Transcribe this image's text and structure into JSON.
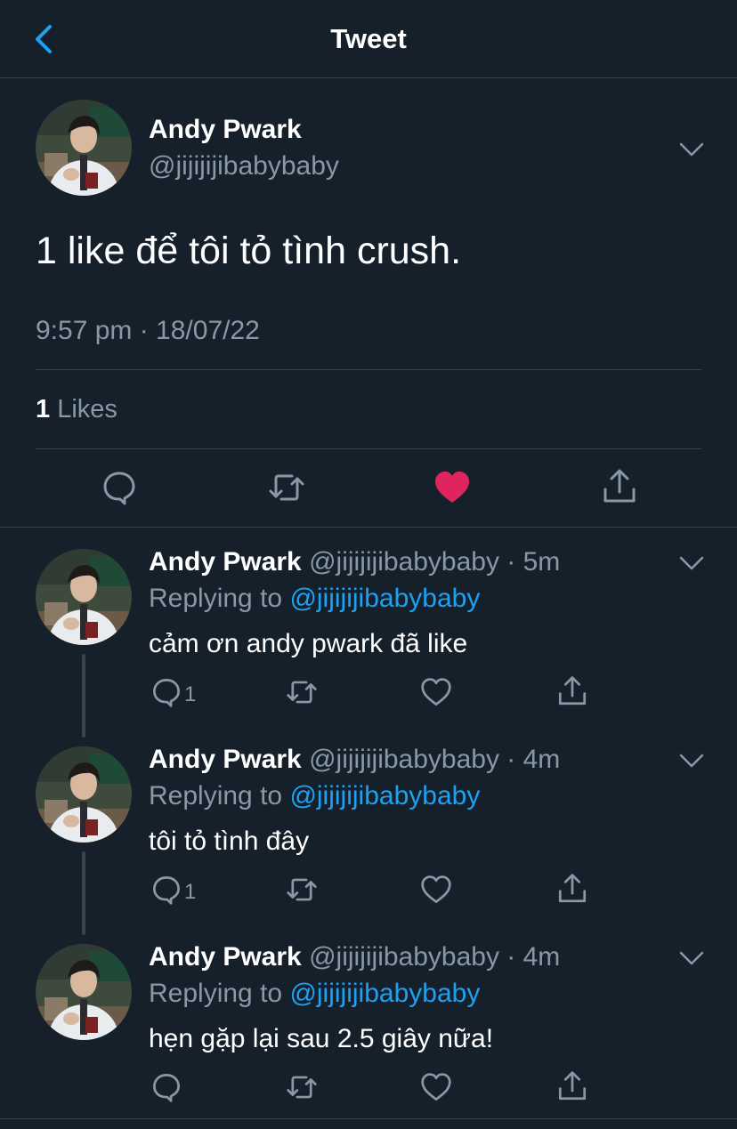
{
  "header": {
    "title": "Tweet"
  },
  "main_tweet": {
    "author_name": "Andy Pwark",
    "author_handle": "@jijijijibabybaby",
    "text": "1 like để tôi tỏ tình crush.",
    "timestamp": "9:57 pm · 18/07/22",
    "likes_count": "1",
    "likes_label": "Likes",
    "liked": true
  },
  "replies": [
    {
      "author_name": "Andy Pwark",
      "meta": "@jijijijibabybaby · 5m",
      "replying_prefix": "Replying to",
      "replying_to": "@jijijijibabybaby",
      "text": "cảm ơn andy pwark đã like",
      "reply_count": "1"
    },
    {
      "author_name": "Andy Pwark",
      "meta": "@jijijijibabybaby · 4m",
      "replying_prefix": "Replying to",
      "replying_to": "@jijijijibabybaby",
      "text": "tôi tỏ tình đây",
      "reply_count": "1"
    },
    {
      "author_name": "Andy Pwark",
      "meta": "@jijijijibabybaby · 4m",
      "replying_prefix": "Replying to",
      "replying_to": "@jijijijibabybaby",
      "text": "hẹn gặp lại sau 2.5 giây nữa!",
      "reply_count": ""
    }
  ],
  "colors": {
    "background": "#15202b",
    "accent": "#1da1f2",
    "like": "#e0245e",
    "secondary_text": "#8899a6",
    "divider": "#38444d"
  },
  "icons": {
    "back": "chevron-left-icon",
    "more": "chevron-down-icon",
    "reply": "comment-icon",
    "retweet": "retweet-icon",
    "like": "heart-icon",
    "share": "share-icon"
  }
}
